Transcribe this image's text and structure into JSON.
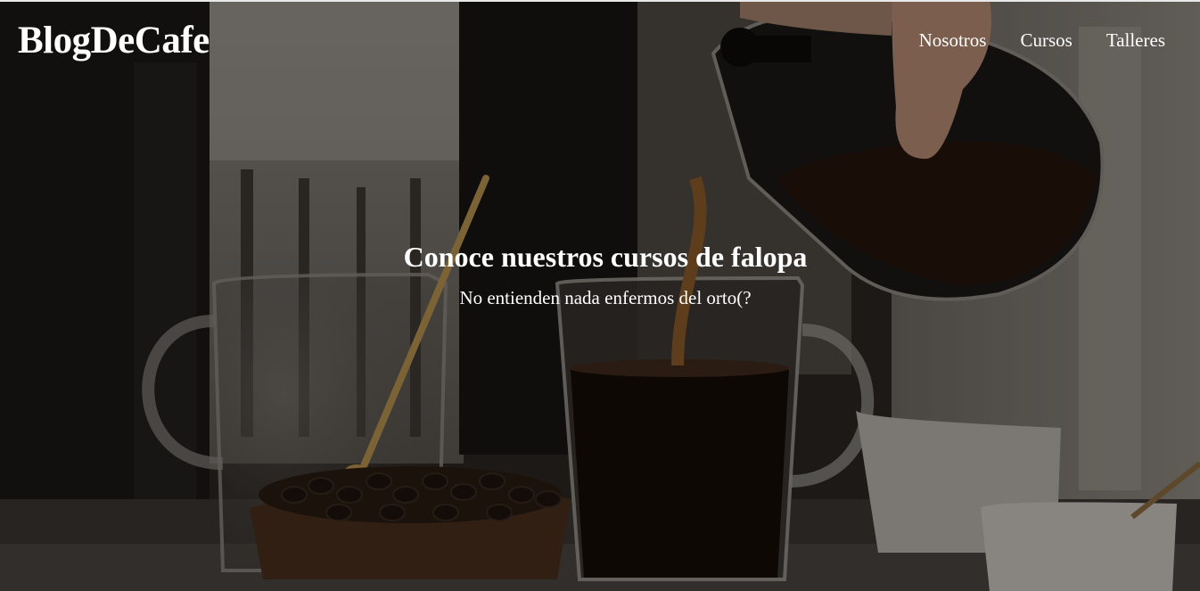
{
  "site": {
    "logo": "BlogDeCafe"
  },
  "nav": {
    "items": [
      "Nosotros",
      "Cursos",
      "Talleres"
    ]
  },
  "hero": {
    "title": "Conoce nuestros cursos de falopa",
    "subtitle": "No entienden nada enfermos del orto(?",
    "overlay_color": "#000000"
  }
}
